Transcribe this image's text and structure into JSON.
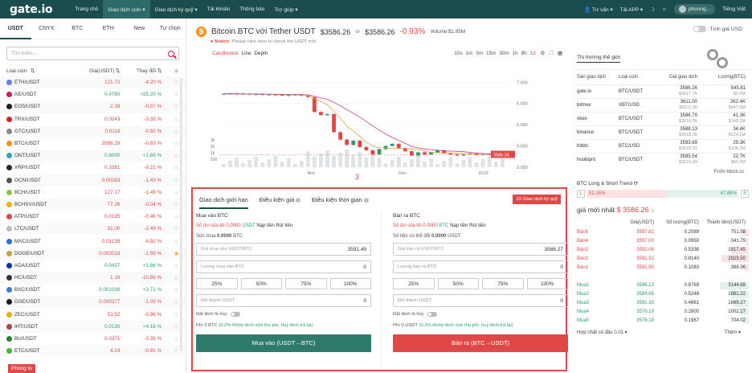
{
  "topbar": {
    "logo": "gate.io",
    "nav": [
      "Trang chủ",
      "Giao dịch coin ▾",
      "Giao dịch ký quỹ ▾",
      "Tài khoản",
      "Thông báo",
      "Trợ giúp ▾"
    ],
    "right": [
      "Tư vấn ▾",
      "Tải APP ▾",
      "phuong...",
      "Tiếng Việt"
    ]
  },
  "left": {
    "tabs": [
      "USDT",
      "CNYX",
      "BTC",
      "ETH",
      "New",
      "Tự chọn"
    ],
    "search_placeholder": "Tìm kiếm...",
    "headers": [
      "Loại coin",
      "Giá(USDT)",
      "Thay đổi"
    ],
    "rows": [
      {
        "pair": "ETH/USDT",
        "price": "121.72",
        "change": "-4.20 %",
        "dir": "down",
        "color": "#627eea"
      },
      {
        "pair": "AE/USDT",
        "price": "0.4760",
        "change": "+25.20 %",
        "dir": "up",
        "color": "#d3185b"
      },
      {
        "pair": "EOS/USDT",
        "price": "2.39",
        "change": "-0.07 %",
        "dir": "down",
        "color": "#222"
      },
      {
        "pair": "TRX/USDT",
        "price": "0.0243",
        "change": "-3.35 %",
        "dir": "down",
        "color": "#e02020"
      },
      {
        "pair": "GTC/USDT",
        "price": "0.0119",
        "change": "-0.92 %",
        "dir": "down",
        "color": "#888"
      },
      {
        "pair": "BTC/USDT",
        "price": "3586.26",
        "change": "-0.93 %",
        "dir": "down",
        "color": "#f7931a"
      },
      {
        "pair": "ONT/USDT",
        "price": "0.6000",
        "change": "+1.69 %",
        "dir": "up",
        "color": "#32a4be"
      },
      {
        "pair": "XRP/USDT",
        "price": "0.3261",
        "change": "-0.21 %",
        "dir": "down",
        "color": "#23292f"
      },
      {
        "pair": "OCN/USDT",
        "price": "0.00283",
        "change": "-1.43 %",
        "dir": "down",
        "color": "#555"
      },
      {
        "pair": "BCH/USDT",
        "price": "127.17",
        "change": "-1.49 %",
        "dir": "down",
        "color": "#8dc351"
      },
      {
        "pair": "BCHSV/USDT",
        "price": "77.26",
        "change": "-0.04 %",
        "dir": "down",
        "color": "#eab300"
      },
      {
        "pair": "ATP/USDT",
        "price": "0.0195",
        "change": "-0.46 %",
        "dir": "down",
        "color": "#e04848"
      },
      {
        "pair": "LTC/USDT",
        "price": "31.00",
        "change": "-2.49 %",
        "dir": "down",
        "color": "#bbb"
      },
      {
        "pair": "MXC/USDT",
        "price": "0.01139",
        "change": "-4.92 %",
        "dir": "down",
        "color": "#2b6de0"
      },
      {
        "pair": "DOGE/USDT",
        "price": "0.002033",
        "change": "-1.59 %",
        "dir": "down",
        "color": "#c2a633",
        "star": true
      },
      {
        "pair": "ADA/USDT",
        "price": "0.0437",
        "change": "+1.86 %",
        "dir": "up",
        "color": "#0033ad"
      },
      {
        "pair": "HC/USDT",
        "price": "1.16",
        "change": "-10.88 %",
        "dir": "down",
        "color": "#333"
      },
      {
        "pair": "BXC/USDT",
        "price": "0.001039",
        "change": "+2.71 %",
        "dir": "up",
        "color": "#3a7bd5"
      },
      {
        "pair": "GSE/USDT",
        "price": "0.000377",
        "change": "-1.05 %",
        "dir": "down",
        "color": "#1a1a1a"
      },
      {
        "pair": "ZEC/USDT",
        "price": "53.52",
        "change": "-0.96 %",
        "dir": "down",
        "color": "#e8b30b"
      },
      {
        "pair": "IHT/USDT",
        "price": "0.0130",
        "change": "+4.16 %",
        "dir": "up",
        "color": "#b0413e"
      },
      {
        "pair": "BU/USDT",
        "price": "0.0371",
        "change": "-3.39 %",
        "dir": "down",
        "color": "#2f7d32"
      },
      {
        "pair": "ETC/USDT",
        "price": "4.24",
        "change": "-0.91 %",
        "dir": "down",
        "color": "#3ab83a"
      }
    ],
    "phong_to": "Phóng to"
  },
  "center": {
    "title": "Bitcoin BTC",
    "with": "với Tether USDT",
    "price": "$3586.26",
    "or": "or",
    "price2": "$3586.26",
    "change": "-0.93%",
    "volume": "Volume:$1.95M",
    "notice_label": "Notice:",
    "notice_text": "Please click here to check the USDT info.",
    "chart_tabs": [
      "Candlestick",
      "Line",
      "Depth"
    ],
    "intervals": [
      "10s",
      "1m",
      "5m",
      "15m",
      "30m",
      "1h",
      "8h",
      "1d"
    ],
    "price_tag": "3586.26",
    "marker": "3",
    "order_tabs": [
      "Giao dịch giới hạn",
      "Điều kiện giá",
      "Điều kiện thời gian"
    ],
    "margin_btn": "3X Giao dịch ký quỹ",
    "buy": {
      "title": "Mua vào BTC",
      "bal_label": "Số dư của tôi",
      "bal_value": "0.0000",
      "bal_unit": "USDT",
      "link1": "Nạp tiền",
      "link2": "Rút tiền",
      "cap_label": "Sức mua",
      "cap_value": "0.0000",
      "cap_unit": "BTC",
      "price_ph": "Giá mua vào USDT/BTC",
      "price_val": "3591.49",
      "amount_ph": "Lượng mua vào BTC",
      "amount_val": "0",
      "pcts": [
        "25%",
        "50%",
        "75%",
        "100%"
      ],
      "total_ph": "Đổi thành USDT",
      "total_val": "0",
      "toggle": "Đặt lệnh là hủy",
      "fee_label": "Phí",
      "fee_value": "0 BTC",
      "fee_note": "(0.2% Khớp lệnh mới thu phí, huỷ lệnh trả lại)",
      "button": "Mua vào (USDT→BTC)"
    },
    "sell": {
      "title": "Bán ra BTC",
      "bal_label": "Số dư của tôi",
      "bal_value": "0.0000",
      "bal_unit": "BTC",
      "link1": "Nạp tiền",
      "link2": "Rút tiền",
      "cap_label": "Số tiền có thể đổi",
      "cap_value": "0.0000",
      "cap_unit": "USDT",
      "price_ph": "Giá bán ra USDT/BTC",
      "price_val": "3586.27",
      "amount_ph": "Lượng bán ra BTC",
      "amount_val": "0",
      "pcts": [
        "25%",
        "50%",
        "75%",
        "100%"
      ],
      "total_ph": "Đổi thành USDT",
      "total_val": "0",
      "toggle": "Đặt lệnh là hủy",
      "fee_label": "Phí",
      "fee_value": "0 USDT",
      "fee_note": "(0.2% Khớp lệnh mới thu phí, huỷ lệnh trả lại)",
      "button": "Bán ra (BTC→USDT)"
    }
  },
  "chart_data": {
    "type": "line",
    "x_ticks": [
      "Nov",
      "Dec",
      "2019",
      "Feb"
    ],
    "y_ticks": [
      "7.000",
      "6.000",
      "5.000",
      "4.000",
      "3.000"
    ],
    "vol_ticks": [
      "3k",
      "2k",
      "1k",
      "500"
    ],
    "ylim": [
      3000,
      7200
    ],
    "close": [
      6450,
      6470,
      6430,
      6460,
      6420,
      6440,
      6410,
      6420,
      6400,
      6380,
      6390,
      6410,
      6360,
      6300,
      5600,
      5450,
      5500,
      4650,
      4300,
      4050,
      4250,
      3950,
      3800,
      3600,
      3850,
      4000,
      4100,
      3900,
      3750,
      3550,
      3700,
      3600,
      3700,
      3800,
      3650,
      3600,
      3550,
      3600,
      3650,
      3580,
      3620,
      3590,
      3600,
      3586
    ]
  },
  "right": {
    "toggle": "Tính giá USD",
    "market_title": "Thị trường thế giới",
    "headers": [
      "Sàn giao dịch",
      "Loại coin",
      "Giá giao dịch",
      "Lượng(BTC)"
    ],
    "rows": [
      {
        "ex": "gate.io",
        "pair": "BTC/USDT",
        "price": "3586.26",
        "sub": "$3617.76",
        "vol": "545.81",
        "vsub": "$2.0M"
      },
      {
        "ex": "bitmex",
        "pair": "XBT/USD",
        "price": "3611.00",
        "sub": "$3611.00",
        "vol": "262.4K",
        "vsub": "$947.5M"
      },
      {
        "ex": "okex",
        "pair": "BTC/USDT",
        "price": "3586.79",
        "sub": "$3616.95",
        "vol": "41.3K",
        "vsub": "$149.2M"
      },
      {
        "ex": "binance",
        "pair": "BTC/USDT",
        "price": "3588.13",
        "sub": "$3618.30",
        "vol": "34.4K",
        "vsub": "$124.1M"
      },
      {
        "ex": "hitbtc",
        "pair": "BTC/USD",
        "price": "3593.69",
        "sub": "$3623.91",
        "vol": "29.3K",
        "vsub": "$106.2M"
      },
      {
        "ex": "huobipro",
        "pair": "BTC/USDT",
        "price": "3585.54",
        "sub": "$3615.69",
        "vol": "22.7K",
        "vsub": "$82.0M"
      }
    ],
    "from": "From block.cc",
    "ls_title": "BTC Long & Short Trend",
    "long_label": "L",
    "short_label": "S",
    "long_pct": "52.15%",
    "short_pct": "47.85%",
    "long_fraction": 0.5215,
    "latest_label": "giá mới nhất",
    "latest_price": "$ 3586.26 ↓",
    "ob_headers": [
      "",
      "Giá(USDT)",
      "Số lượng(BTC)",
      "Thành tiền(USDT)"
    ],
    "asks": [
      {
        "lbl": "Bán5",
        "price": "3597.81",
        "qty": "0.2089",
        "total": "751.58",
        "w": 0.2
      },
      {
        "lbl": "Bán4",
        "price": "3597.00",
        "qty": "0.0950",
        "total": "341.79",
        "w": 0.1
      },
      {
        "lbl": "Bán3",
        "price": "3592.08",
        "qty": "0.5338",
        "total": "1917.45",
        "w": 0.55
      },
      {
        "lbl": "Bán2",
        "price": "3591.52",
        "qty": "0.8140",
        "total": "2923.50",
        "w": 0.85
      },
      {
        "lbl": "Bán1",
        "price": "3591.50",
        "qty": "0.1083",
        "total": "388.96",
        "w": 0.12
      }
    ],
    "bids": [
      {
        "lbl": "Mua1",
        "price": "3586.13",
        "qty": "0.8769",
        "total": "3144.68",
        "w": 0.9
      },
      {
        "lbl": "Mua2",
        "price": "3584.65",
        "qty": "0.5248",
        "total": "1881.22",
        "w": 0.55
      },
      {
        "lbl": "Mua3",
        "price": "3581.35",
        "qty": "0.4661",
        "total": "1669.27",
        "w": 0.48
      },
      {
        "lbl": "Mua4",
        "price": "3579.19",
        "qty": "0.2800",
        "total": "1002.17",
        "w": 0.3
      },
      {
        "lbl": "Mua5",
        "price": "3579.18",
        "qty": "0.1967",
        "total": "704.02",
        "w": 0.2
      }
    ],
    "merge_label": "Hợp nhất số đầu",
    "merge_value": "0.01 ▾",
    "more": "Thêm ▾"
  }
}
